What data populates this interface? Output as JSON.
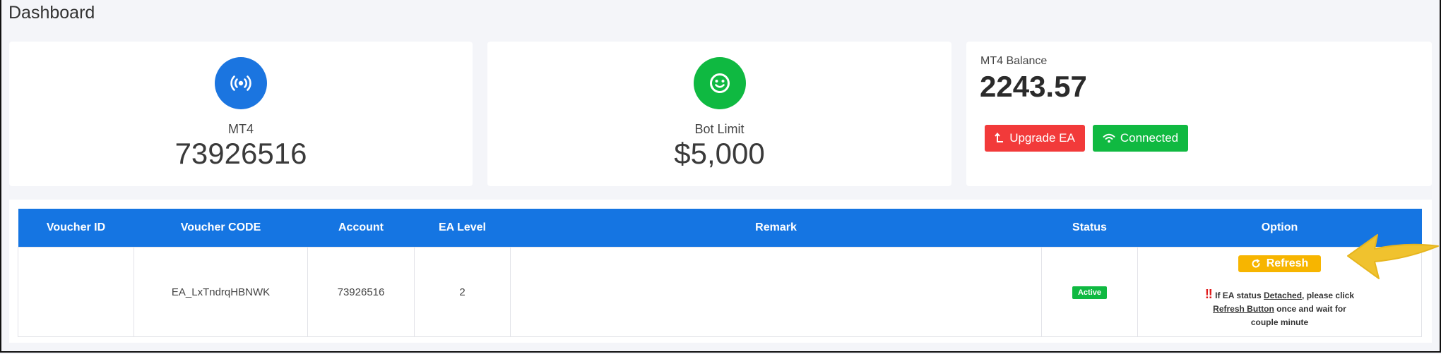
{
  "page": {
    "title": "Dashboard"
  },
  "cards": {
    "mt4": {
      "label": "MT4",
      "value": "73926516",
      "icon": "broadcast-icon",
      "color": "#1b75e0"
    },
    "bot_limit": {
      "label": "Bot Limit",
      "value": "$5,000",
      "icon": "smile-icon",
      "color": "#0fb941"
    },
    "balance": {
      "label": "MT4 Balance",
      "value": "2243.57",
      "upgrade_label": "Upgrade EA",
      "connected_label": "Connected"
    }
  },
  "table": {
    "headers": [
      "Voucher ID",
      "Voucher CODE",
      "Account",
      "EA Level",
      "Remark",
      "Status",
      "Option"
    ],
    "rows": [
      {
        "voucher_id": "",
        "voucher_code": "EA_LxTndrqHBNWK",
        "account": "73926516",
        "ea_level": "2",
        "remark": "",
        "status": "Active",
        "option": {
          "refresh_label": "Refresh",
          "note_prefix": "If EA status ",
          "note_detached": "Detached",
          "note_mid": ", please click ",
          "note_refresh_button": "Refresh Button",
          "note_suffix": " once and wait for couple minute"
        }
      }
    ]
  },
  "colors": {
    "header_blue": "#1575e2",
    "danger": "#f23a3a",
    "success": "#10b941",
    "warning": "#f7b500",
    "arrow": "#f0c22e"
  }
}
